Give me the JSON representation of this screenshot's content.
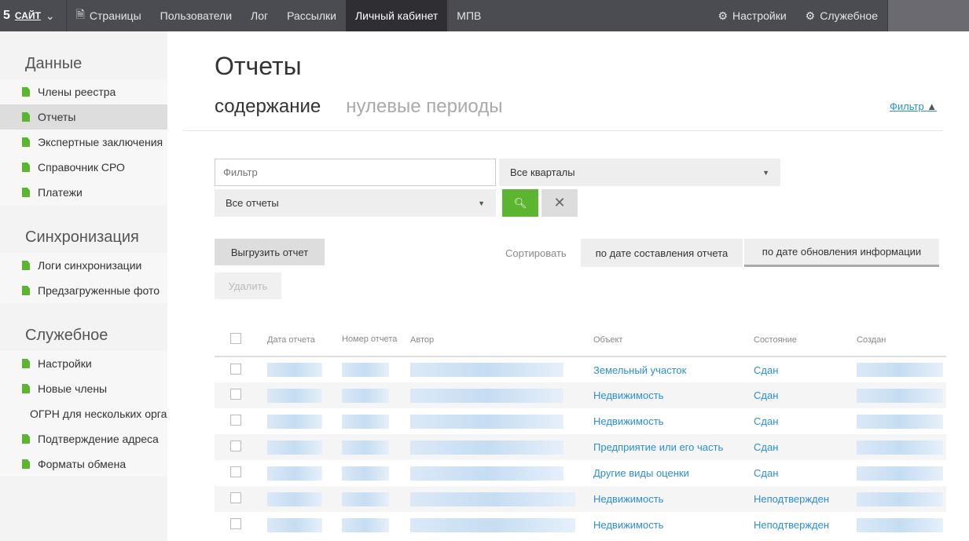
{
  "topbar": {
    "logo": "5",
    "site": "САЙТ",
    "nav": [
      "Страницы",
      "Пользователи",
      "Лог",
      "Рассылки",
      "Личный кабинет",
      "МПВ"
    ],
    "active": "Личный кабинет",
    "settings": "Настройки",
    "service": "Служебное"
  },
  "sidebar": {
    "sections": [
      {
        "title": "Данные",
        "items": [
          "Члены реестра",
          "Отчеты",
          "Экспертные заключения",
          "Справочник СРО",
          "Платежи"
        ]
      },
      {
        "title": "Синхронизация",
        "items": [
          "Логи синхронизации",
          "Предзагруженные фото"
        ]
      },
      {
        "title": "Служебное",
        "items": [
          "Настройки",
          "Новые члены",
          "ОГРН для нескольких организаций",
          "Подтверждение адреса",
          "Форматы обмена"
        ]
      }
    ],
    "active": "Отчеты"
  },
  "page": {
    "title": "Отчеты",
    "tabs": [
      "содержание",
      "нулевые периоды"
    ],
    "filter_link": "Фильтр"
  },
  "filters": {
    "placeholder": "Фильтр",
    "quarters": "Все кварталы",
    "reports": "Все отчеты"
  },
  "actions": {
    "export": "Выгрузить отчет",
    "delete": "Удалить",
    "sort_label": "Сортировать",
    "sort1": "по дате составления отчета",
    "sort2": "по дате обновления информации"
  },
  "table": {
    "headers": [
      "Дата отчета",
      "Номер отчета",
      "Автор",
      "Объект",
      "Состояние",
      "Создан"
    ],
    "rows": [
      {
        "object": "Земельный участок",
        "status": "Сдан"
      },
      {
        "object": "Недвижимость",
        "status": "Сдан"
      },
      {
        "object": "Недвижимость",
        "status": "Сдан"
      },
      {
        "object": "Предприятие или его часть",
        "status": "Сдан"
      },
      {
        "object": "Другие виды оценки",
        "status": "Сдан"
      },
      {
        "object": "Недвижимость",
        "status": "Неподтвержден"
      },
      {
        "object": "Недвижимость",
        "status": "Неподтвержден"
      }
    ]
  },
  "colors": {
    "accent": "#5cb531",
    "link": "#2a8fd6",
    "topbar": "#4b4b52"
  }
}
